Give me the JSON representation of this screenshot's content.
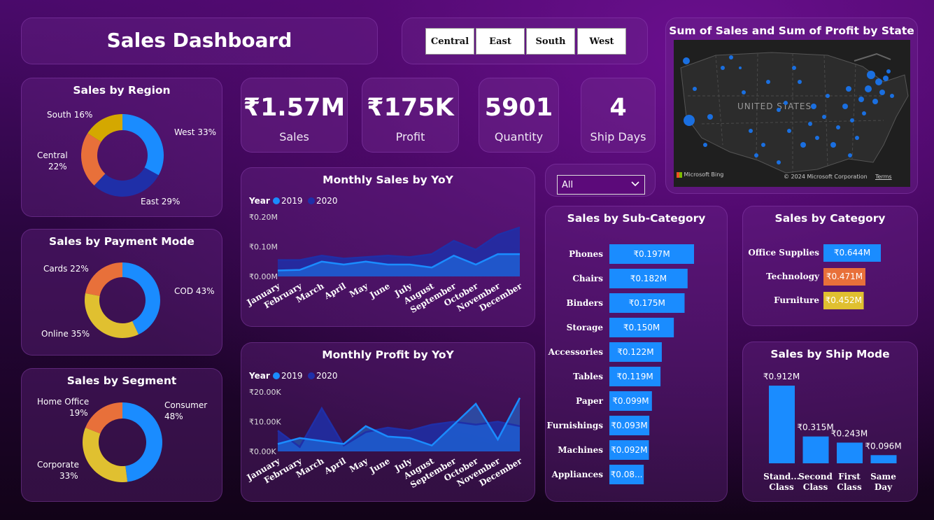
{
  "header": {
    "title": "Sales Dashboard"
  },
  "region_slicer": {
    "options": [
      "Central",
      "East",
      "South",
      "West"
    ]
  },
  "map": {
    "title": "Sum of Sales and Sum of Profit by State",
    "country_label": "UNITED STATES",
    "bing_label": "Microsoft Bing",
    "copyright": "© 2024 Microsoft Corporation",
    "terms": "Terms"
  },
  "kpis": [
    {
      "value": "₹1.57M",
      "label": "Sales"
    },
    {
      "value": "₹175K",
      "label": "Profit"
    },
    {
      "value": "5901",
      "label": "Quantity"
    },
    {
      "value": "4",
      "label": "Ship Days"
    }
  ],
  "dropdown": {
    "selected": "All"
  },
  "colors": {
    "blue": "#1a8cff",
    "navy": "#1f2fa8",
    "orange": "#e8703a",
    "yellow": "#e0c030",
    "gold": "#d4a800"
  },
  "chart_data": [
    {
      "id": "region",
      "type": "pie",
      "title": "Sales by Region",
      "slices": [
        {
          "label": "West 33%",
          "value": 33,
          "color": "#1a8cff"
        },
        {
          "label": "East 29%",
          "value": 29,
          "color": "#1f2fa8"
        },
        {
          "label": "Central 22%",
          "value": 22,
          "color": "#e8703a"
        },
        {
          "label": "South 16%",
          "value": 16,
          "color": "#d4a800"
        }
      ]
    },
    {
      "id": "payment",
      "type": "pie",
      "title": "Sales by Payment Mode",
      "slices": [
        {
          "label": "COD 43%",
          "value": 43,
          "color": "#1a8cff"
        },
        {
          "label": "Online 35%",
          "value": 35,
          "color": "#e0c030"
        },
        {
          "label": "Cards 22%",
          "value": 22,
          "color": "#e8703a"
        }
      ]
    },
    {
      "id": "segment",
      "type": "pie",
      "title": "Sales by Segment",
      "slices": [
        {
          "label": "Consumer 48%",
          "value": 48,
          "color": "#1a8cff"
        },
        {
          "label": "Corporate 33%",
          "value": 33,
          "color": "#e0c030"
        },
        {
          "label": "Home Office 19%",
          "value": 19,
          "color": "#e8703a"
        }
      ]
    },
    {
      "id": "monthly_sales",
      "type": "area",
      "title": "Monthly Sales by YoY",
      "legend_title": "Year",
      "categories": [
        "January",
        "February",
        "March",
        "April",
        "May",
        "June",
        "July",
        "August",
        "September",
        "October",
        "November",
        "December"
      ],
      "yticks": [
        "₹0.20M",
        "₹0.10M",
        "₹0.00M"
      ],
      "ylim": [
        0,
        0.2
      ],
      "series": [
        {
          "name": "2019",
          "values": [
            0.02,
            0.022,
            0.05,
            0.04,
            0.05,
            0.04,
            0.04,
            0.03,
            0.07,
            0.04,
            0.075,
            0.075
          ],
          "color": "#1a8cff"
        },
        {
          "name": "2020",
          "values": [
            0.055,
            0.055,
            0.07,
            0.06,
            0.065,
            0.07,
            0.065,
            0.075,
            0.12,
            0.09,
            0.14,
            0.165
          ],
          "color": "#1f2fa8"
        }
      ]
    },
    {
      "id": "monthly_profit",
      "type": "area",
      "title": "Monthly Profit by YoY",
      "legend_title": "Year",
      "categories": [
        "January",
        "February",
        "March",
        "April",
        "May",
        "June",
        "July",
        "August",
        "September",
        "October",
        "November",
        "December"
      ],
      "yticks": [
        "₹20.00K",
        "₹10.00K",
        "₹0.00K"
      ],
      "ylim": [
        0,
        20
      ],
      "series": [
        {
          "name": "2019",
          "values": [
            2.5,
            4.5,
            3.5,
            2.5,
            8.5,
            5,
            4.5,
            2,
            9,
            16,
            4,
            18
          ],
          "color": "#1a8cff"
        },
        {
          "name": "2020",
          "values": [
            7,
            1.5,
            14.5,
            2,
            6.5,
            8,
            7,
            9,
            10,
            9,
            10,
            8.5
          ],
          "color": "#1f2fa8"
        }
      ]
    },
    {
      "id": "subcategory",
      "type": "bar",
      "title": "Sales by Sub-Category",
      "categories": [
        "Phones",
        "Chairs",
        "Binders",
        "Storage",
        "Accessories",
        "Tables",
        "Paper",
        "Furnishings",
        "Machines",
        "Appliances"
      ],
      "values": [
        0.197,
        0.182,
        0.175,
        0.15,
        0.122,
        0.119,
        0.099,
        0.093,
        0.092,
        0.08
      ],
      "labels": [
        "₹0.197M",
        "₹0.182M",
        "₹0.175M",
        "₹0.150M",
        "₹0.122M",
        "₹0.119M",
        "₹0.099M",
        "₹0.093M",
        "₹0.092M",
        "₹0.08..."
      ],
      "color": "#1a8cff"
    },
    {
      "id": "category",
      "type": "bar",
      "title": "Sales by Category",
      "categories": [
        "Office Supplies",
        "Technology",
        "Furniture"
      ],
      "values": [
        0.644,
        0.471,
        0.452
      ],
      "labels": [
        "₹0.644M",
        "₹0.471M",
        "₹0.452M"
      ],
      "colors": [
        "#1a8cff",
        "#e8703a",
        "#e0c030"
      ]
    },
    {
      "id": "shipmode",
      "type": "bar",
      "title": "Sales by Ship Mode",
      "categories": [
        "Stand... Class",
        "Second Class",
        "First Class",
        "Same Day"
      ],
      "values": [
        0.912,
        0.315,
        0.243,
        0.096
      ],
      "labels": [
        "₹0.912M",
        "₹0.315M",
        "₹0.243M",
        "₹0.096M"
      ],
      "color": "#1a8cff"
    }
  ]
}
